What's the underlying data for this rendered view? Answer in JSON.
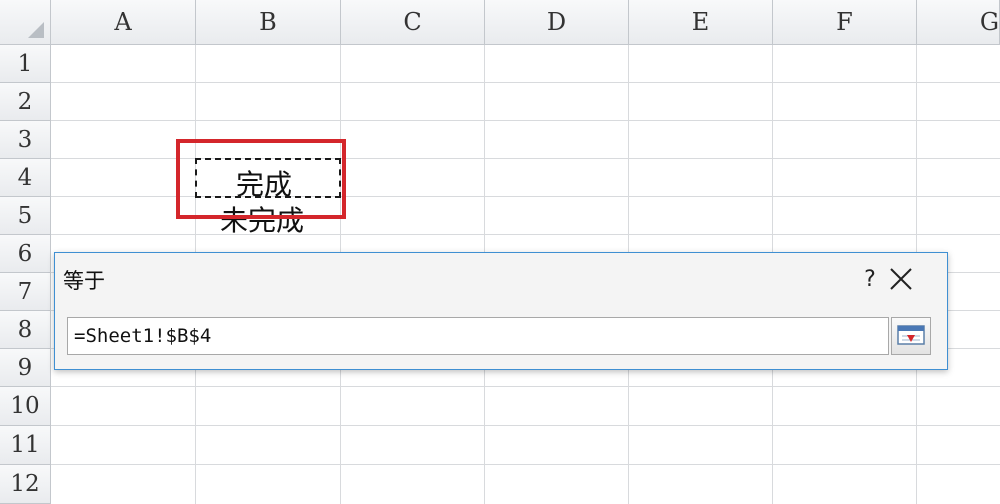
{
  "sheet": {
    "columns": [
      "A",
      "B",
      "C",
      "D",
      "E",
      "F",
      "G"
    ],
    "rows": [
      "1",
      "2",
      "3",
      "4",
      "5",
      "6",
      "7",
      "8",
      "9",
      "10",
      "11",
      "12"
    ],
    "cells": {
      "B4": "完成",
      "B5": "未完成"
    }
  },
  "dialog": {
    "title": "等于",
    "help_label": "?",
    "reference_value": "=Sheet1!$B$4"
  },
  "colors": {
    "highlight": "#d4262b",
    "dialog_border": "#3f8fd2"
  },
  "icons": {
    "close": "close-icon",
    "collapse": "collapse-dialog-icon",
    "corner": "select-all-icon"
  }
}
